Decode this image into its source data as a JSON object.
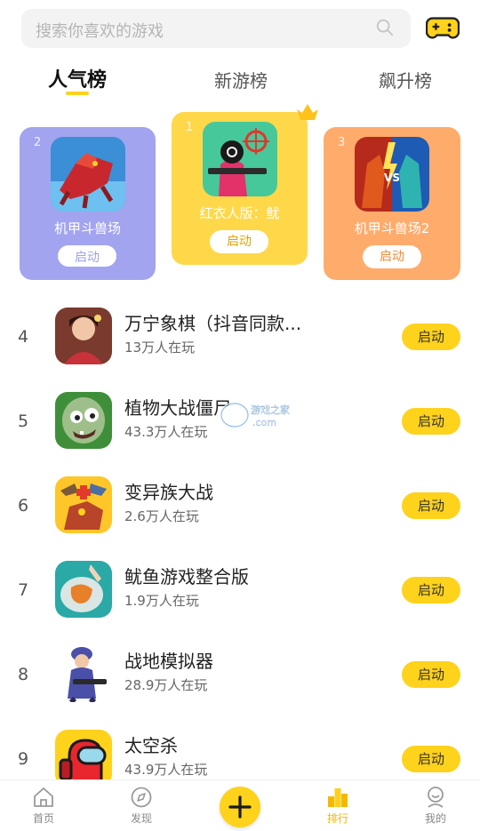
{
  "search": {
    "placeholder": "搜索你喜欢的游戏"
  },
  "tabs": [
    {
      "label": "人气榜",
      "active": true
    },
    {
      "label": "新游榜",
      "active": false
    },
    {
      "label": "飙升榜",
      "active": false
    }
  ],
  "podium": [
    {
      "rank": "2",
      "name": "机甲斗兽场",
      "button": "启动",
      "bg": "#a2a4ef",
      "button_color": "#9fa2ea"
    },
    {
      "rank": "1",
      "name": "红衣人版：鱿",
      "button": "启动",
      "bg": "#ffd84a",
      "button_color": "#e5a400"
    },
    {
      "rank": "3",
      "name": "机甲斗兽场2",
      "button": "启动",
      "bg": "#ffab6b",
      "button_color": "#f08b3c"
    }
  ],
  "list": [
    {
      "rank": "4",
      "title": "万宁象棋（抖音同款...",
      "players": "13万人在玩",
      "button": "启动"
    },
    {
      "rank": "5",
      "title": "植物大战僵尸",
      "players": "43.3万人在玩",
      "button": "启动"
    },
    {
      "rank": "6",
      "title": "变异族大战",
      "players": "2.6万人在玩",
      "button": "启动"
    },
    {
      "rank": "7",
      "title": "鱿鱼游戏整合版",
      "players": "1.9万人在玩",
      "button": "启动"
    },
    {
      "rank": "8",
      "title": "战地模拟器",
      "players": "28.9万人在玩",
      "button": "启动"
    },
    {
      "rank": "9",
      "title": "太空杀",
      "players": "43.9万人在玩",
      "button": "启动"
    }
  ],
  "watermark": {
    "line1": "游戏之家",
    "line2": ".com"
  },
  "nav": [
    {
      "label": "首页",
      "icon": "home-icon",
      "active": false
    },
    {
      "label": "发现",
      "icon": "compass-icon",
      "active": false
    },
    {
      "label": "排行",
      "icon": "ranking-icon",
      "active": true
    },
    {
      "label": "我的",
      "icon": "profile-icon",
      "active": false
    }
  ],
  "colors": {
    "accent": "#ffd21c",
    "nav_active": "#f2b600"
  }
}
